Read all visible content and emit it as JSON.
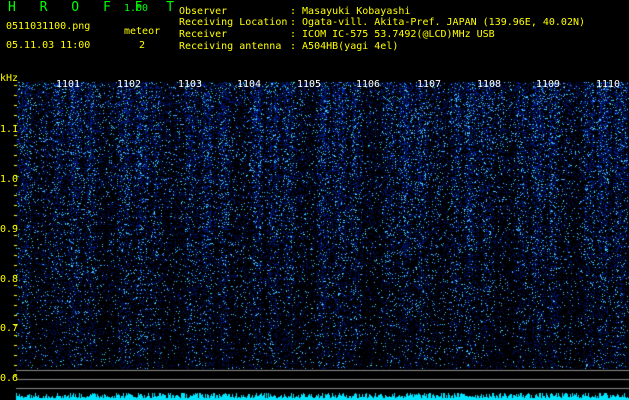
{
  "header": {
    "app_title": "H R O F F T",
    "version": "1.00",
    "file_name": "0511031100.png",
    "timestamp": "05.11.03 11:00",
    "meteor_label": "meteor",
    "meteor_count": "2"
  },
  "station_info": [
    {
      "label": "Observer",
      "value": ": Masayuki Kobayashi"
    },
    {
      "label": "Receiving Location",
      "value": ": Ogata-vill. Akita-Pref. JAPAN (139.96E, 40.02N)"
    },
    {
      "label": "Receiver",
      "value": ": ICOM IC-575 53.7492(@LCD)MHz USB"
    },
    {
      "label": "Receiving antenna",
      "value": ": A504HB(yagi 4el)"
    }
  ],
  "axes": {
    "y_unit": "kHz",
    "y_ticks": [
      "1.1",
      "1.0",
      "0.9",
      "0.8",
      "0.7",
      "0.6"
    ],
    "x_ticks": [
      "1101",
      "1102",
      "1103",
      "1104",
      "1105",
      "1106",
      "1107",
      "1108",
      "1109",
      "1110"
    ]
  },
  "colors": {
    "background": "#000000",
    "label_yellow": "#ffff00",
    "title_green": "#00ff00",
    "time_labels": "#ffffff",
    "noise_dark": "#00107a",
    "noise_bright": "#3fb8ff",
    "signal_cyan": "#00e5ff"
  }
}
